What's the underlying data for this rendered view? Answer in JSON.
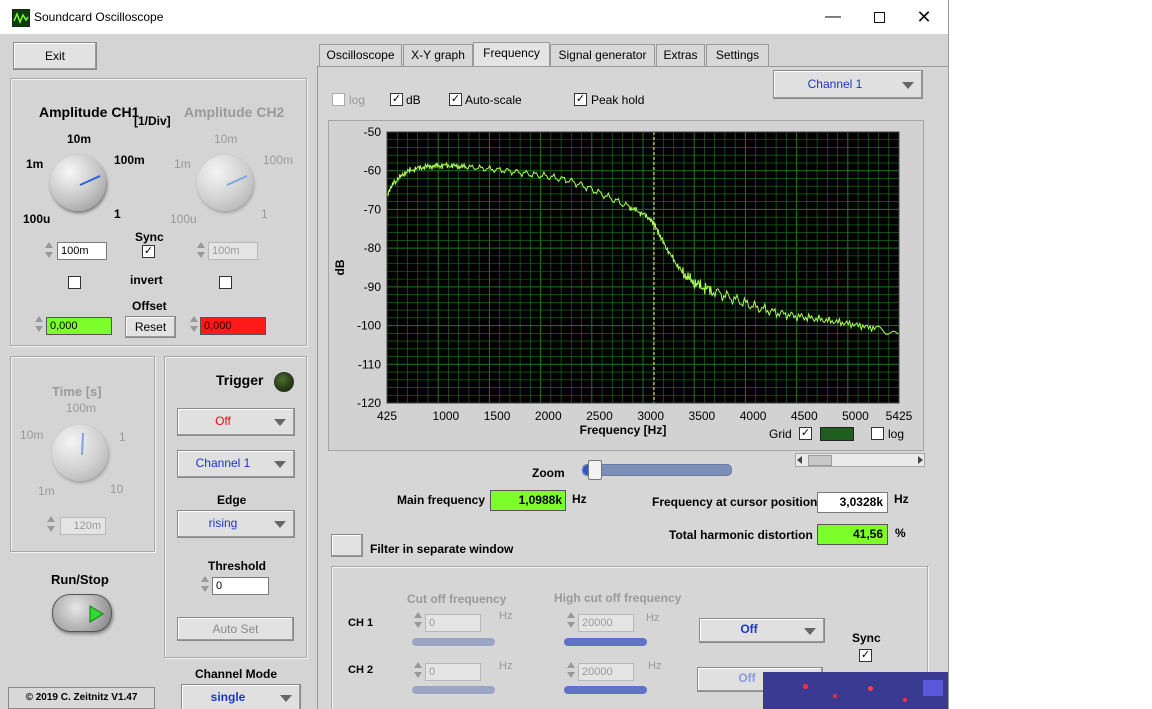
{
  "window": {
    "title": "Soundcard Oscilloscope",
    "min_icon": "minimize-icon",
    "max_icon": "maximize-icon",
    "close_icon": "close-icon"
  },
  "exit_label": "Exit",
  "amplitude": {
    "ch1_title": "Amplitude CH1",
    "unit": "[1/Div]",
    "ch2_title": "Amplitude CH2",
    "knob_labels": {
      "a": "1m",
      "b": "10m",
      "c": "100m",
      "d": "1",
      "e": "100u"
    },
    "ch1_value": "100m",
    "ch2_value": "100m",
    "sync_label": "Sync",
    "sync_checked": "✓",
    "invert_label": "invert",
    "offset_label": "Offset",
    "offset_ch1": "0,000",
    "offset_ch2": "0,000",
    "reset_label": "Reset"
  },
  "time": {
    "title": "Time [s]",
    "knob_labels": {
      "a": "100m",
      "b": "10m",
      "c": "1",
      "d": "1m",
      "e": "10"
    },
    "value": "120m"
  },
  "trigger": {
    "title": "Trigger",
    "mode": "Off",
    "channel": "Channel 1",
    "edge_label": "Edge",
    "edge": "rising",
    "threshold_label": "Threshold",
    "threshold": "0",
    "autoset_label": "Auto Set"
  },
  "runstop_label": "Run/Stop",
  "copyright": "© 2019  C. Zeitnitz V1.47",
  "channel_mode_label": "Channel Mode",
  "channel_mode": "single",
  "tabs": [
    "Oscilloscope",
    "X-Y graph",
    "Frequency",
    "Signal generator",
    "Extras",
    "Settings"
  ],
  "frequency": {
    "channel_select": "Channel 1",
    "opt_log": "log",
    "opt_db": "dB",
    "opt_autoscale": "Auto-scale",
    "opt_peakhold": "Peak hold",
    "check": "✓",
    "grid_label": "Grid",
    "grid_log_label": "log",
    "zoom_label": "Zoom",
    "main_freq_label": "Main frequency",
    "main_freq_value": "1,0988k",
    "main_freq_unit": "Hz",
    "cursor_label": "Frequency at cursor position",
    "cursor_value": "3,0328k",
    "cursor_unit": "Hz",
    "thd_label": "Total harmonic distortion",
    "thd_value": "41,56",
    "thd_unit": "%",
    "filter_window_label": "Filter in separate window"
  },
  "filter": {
    "cutoff_label": "Cut off frequency",
    "highcut_label": "High cut off frequency",
    "hz": "Hz",
    "ch1_label": "CH 1",
    "ch2_label": "CH 2",
    "ch1_cutoff": "0",
    "ch1_highcut": "20000",
    "ch2_cutoff": "0",
    "ch2_highcut": "20000",
    "ch1_mode": "Off",
    "ch2_mode": "Off",
    "sync_label": "Sync",
    "sync_checked": "✓"
  },
  "chart_data": {
    "type": "line",
    "title": "",
    "xlabel": "Frequency [Hz]",
    "ylabel": "dB",
    "xlim": [
      425,
      5425
    ],
    "ylim": [
      -120,
      -50
    ],
    "xticks": [
      425,
      1000,
      1500,
      2000,
      2500,
      3000,
      3500,
      4000,
      4500,
      5000,
      5425
    ],
    "yticks": [
      -50,
      -60,
      -70,
      -80,
      -90,
      -100,
      -110,
      -120
    ],
    "grid": true,
    "cursor_x": 3033,
    "colors": {
      "background": "#000000",
      "grid": "#1f7a1f",
      "trace": "#a8ff5a",
      "cursor": "#e8e070"
    },
    "x": [
      425,
      500,
      600,
      700,
      800,
      900,
      1000,
      1100,
      1200,
      1400,
      1600,
      1800,
      2000,
      2200,
      2400,
      2600,
      2800,
      2900,
      3000,
      3050,
      3100,
      3200,
      3300,
      3400,
      3500,
      3600,
      3800,
      4000,
      4200,
      4400,
      4600,
      4800,
      5000,
      5200,
      5425
    ],
    "y": [
      -66,
      -63,
      -60.5,
      -59.5,
      -59,
      -58.8,
      -58.6,
      -58.8,
      -59,
      -59.5,
      -60,
      -60.8,
      -61.5,
      -62.5,
      -64.5,
      -67,
      -69.5,
      -70.8,
      -72.5,
      -74.5,
      -77.5,
      -82,
      -86,
      -88.5,
      -90,
      -91,
      -93,
      -95,
      -96.5,
      -97.5,
      -98.2,
      -99,
      -99.8,
      -100.8,
      -102
    ]
  }
}
